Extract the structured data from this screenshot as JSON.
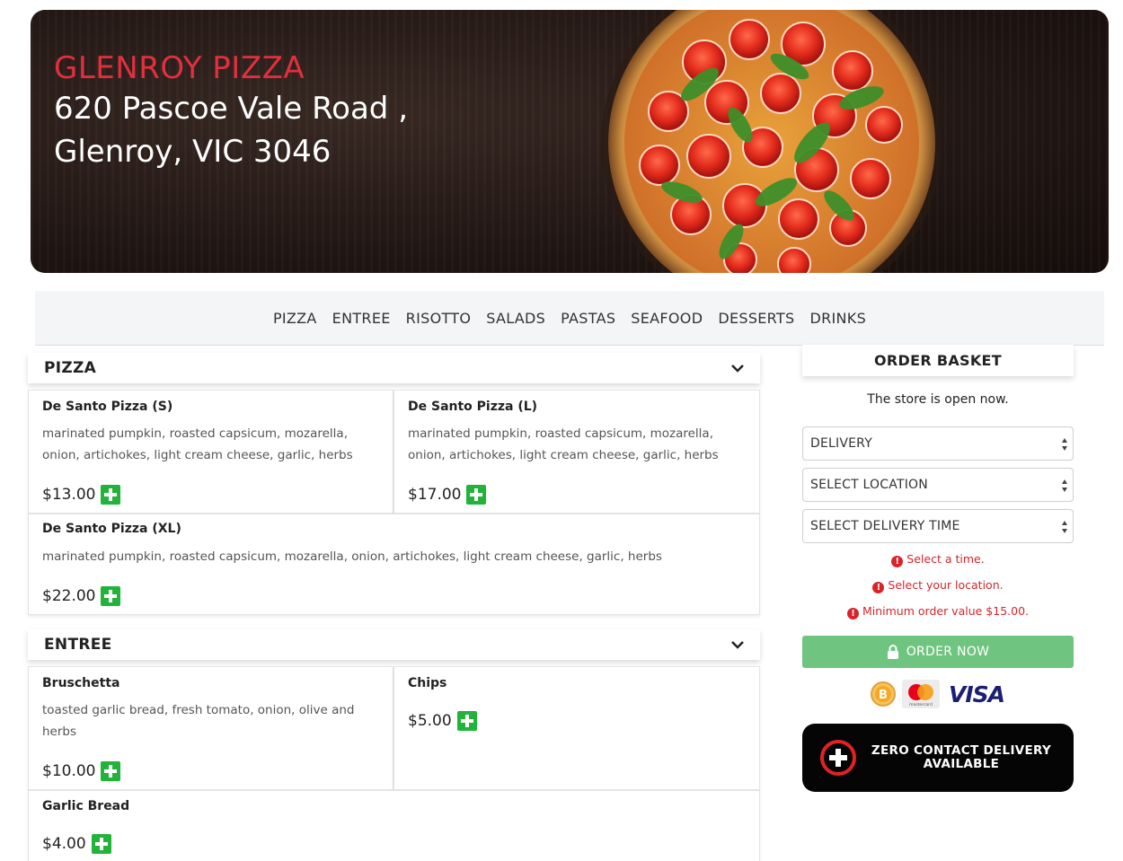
{
  "store": {
    "name": "GLENROY PIZZA",
    "address_line1": "620 Pascoe Vale Road ,",
    "address_line2": "Glenroy, VIC 3046"
  },
  "categories": [
    "PIZZA",
    "ENTREE",
    "RISOTTO",
    "SALADS",
    "PASTAS",
    "SEAFOOD",
    "DESSERTS",
    "DRINKS"
  ],
  "sections": [
    {
      "title": "PIZZA",
      "items": [
        {
          "name": "De Santo Pizza (S)",
          "description": "marinated pumpkin, roasted capsicum, mozarella, onion, artichokes, light cream cheese, garlic, herbs",
          "price": "$13.00"
        },
        {
          "name": "De Santo Pizza (L)",
          "description": "marinated pumpkin, roasted capsicum, mozarella, onion, artichokes, light cream cheese, garlic, herbs",
          "price": "$17.00"
        },
        {
          "name": "De Santo Pizza (XL)",
          "description": "marinated pumpkin, roasted capsicum, mozarella, onion, artichokes, light cream cheese, garlic, herbs",
          "price": "$22.00"
        }
      ]
    },
    {
      "title": "ENTREE",
      "items": [
        {
          "name": "Bruschetta",
          "description": "toasted garlic bread, fresh tomato, onion, olive and herbs",
          "price": "$10.00"
        },
        {
          "name": "Chips",
          "description": "",
          "price": "$5.00"
        },
        {
          "name": "Garlic Bread",
          "description": "",
          "price": "$4.00"
        }
      ]
    }
  ],
  "basket": {
    "title": "ORDER BASKET",
    "status": "The store is open now.",
    "order_type": "DELIVERY",
    "location": "SELECT LOCATION",
    "delivery_time": "SELECT DELIVERY TIME",
    "errors": [
      "Select a time.",
      "Select your location.",
      "Minimum order value $15.00."
    ],
    "order_button": "ORDER NOW",
    "payments": {
      "visa": "VISA",
      "mastercard": "mastercard"
    },
    "zero_contact_line1": "ZERO CONTACT DELIVERY",
    "zero_contact_line2": "AVAILABLE"
  },
  "colors": {
    "accent_red": "#e0303d",
    "add_green": "#21b33a",
    "order_button_green": "#6fc47f",
    "error_red": "#d8232a"
  }
}
